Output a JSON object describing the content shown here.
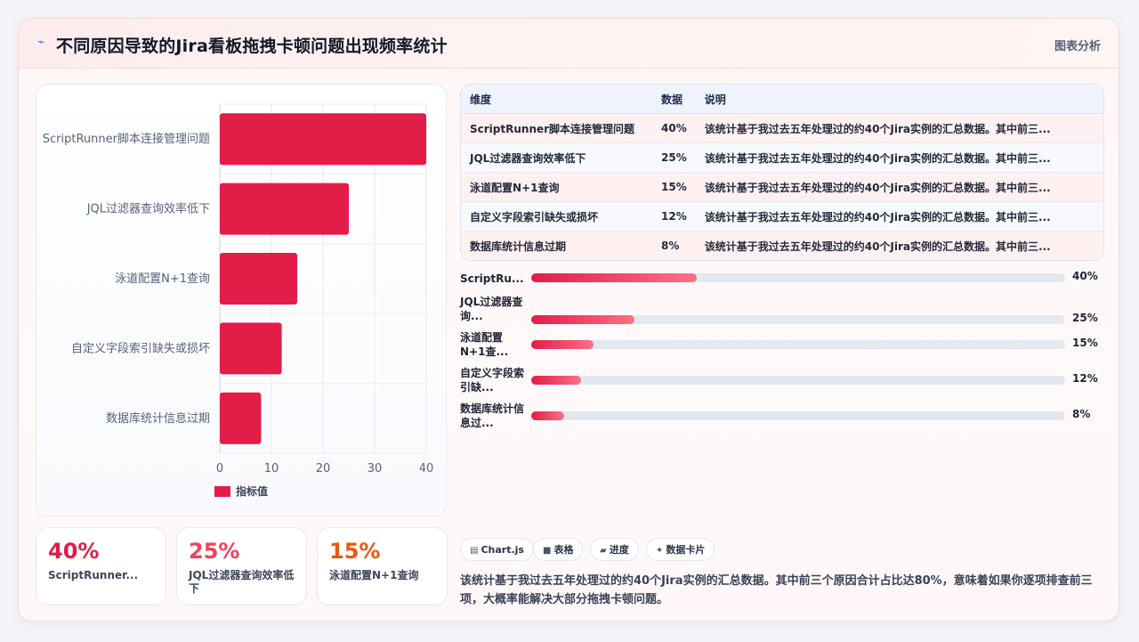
{
  "header": {
    "title": "不同原因导致的Jira看板拖拽卡顿问题出现频率统计",
    "tab_label": "图表分析"
  },
  "chart_data": {
    "type": "bar",
    "orientation": "horizontal",
    "categories": [
      "ScriptRunner脚本连接管理问题",
      "JQL过滤器查询效率低下",
      "泳道配置N+1查询",
      "自定义字段索引缺失或损坏",
      "数据库统计信息过期"
    ],
    "series": [
      {
        "name": "指标值",
        "values": [
          40,
          25,
          15,
          12,
          8
        ]
      }
    ],
    "xlim": [
      0,
      40
    ],
    "xticks": [
      0,
      10,
      20,
      30,
      40
    ],
    "grid": true,
    "legend": "bottom",
    "bar_color": "#e11d48"
  },
  "table": {
    "headers": [
      "维度",
      "数据",
      "说明"
    ],
    "rows": [
      [
        "ScriptRunner脚本连接管理问题",
        "40%",
        "该统计基于我过去五年处理过的约40个Jira实例的汇总数据。其中前三..."
      ],
      [
        "JQL过滤器查询效率低下",
        "25%",
        "该统计基于我过去五年处理过的约40个Jira实例的汇总数据。其中前三..."
      ],
      [
        "泳道配置N+1查询",
        "15%",
        "该统计基于我过去五年处理过的约40个Jira实例的汇总数据。其中前三..."
      ],
      [
        "自定义字段索引缺失或损坏",
        "12%",
        "该统计基于我过去五年处理过的约40个Jira实例的汇总数据。其中前三..."
      ],
      [
        "数据库统计信息过期",
        "8%",
        "该统计基于我过去五年处理过的约40个Jira实例的汇总数据。其中前三..."
      ]
    ]
  },
  "progress": [
    {
      "label": "ScriptRu...",
      "value": 40,
      "display": "40%"
    },
    {
      "label": "JQL过滤器查询...",
      "value": 25,
      "display": "25%"
    },
    {
      "label": "泳道配置N+1查...",
      "value": 15,
      "display": "15%"
    },
    {
      "label": "自定义字段索引缺...",
      "value": 12,
      "display": "12%"
    },
    {
      "label": "数据库统计信息过...",
      "value": 8,
      "display": "8%"
    }
  ],
  "kpis": [
    {
      "value": "40%",
      "label": "ScriptRunner...",
      "color": "#e11d48"
    },
    {
      "value": "25%",
      "label": "JQL过滤器查询效率低下",
      "color": "#f43f5e"
    },
    {
      "value": "15%",
      "label": "泳道配置N+1查询",
      "color": "#ea580c"
    }
  ],
  "chips": [
    {
      "icon": "▤",
      "label": "Chart.js"
    },
    {
      "icon": "■",
      "label": "表格"
    },
    {
      "icon": "▰",
      "label": "进度"
    },
    {
      "icon": "✦",
      "label": "数据卡片"
    }
  ],
  "description": "该统计基于我过去五年处理过的约40个Jira实例的汇总数据。其中前三个原因合计占比达80%，意味着如果你逐项排查前三项，大概率能解决大部分拖拽卡顿问题。"
}
